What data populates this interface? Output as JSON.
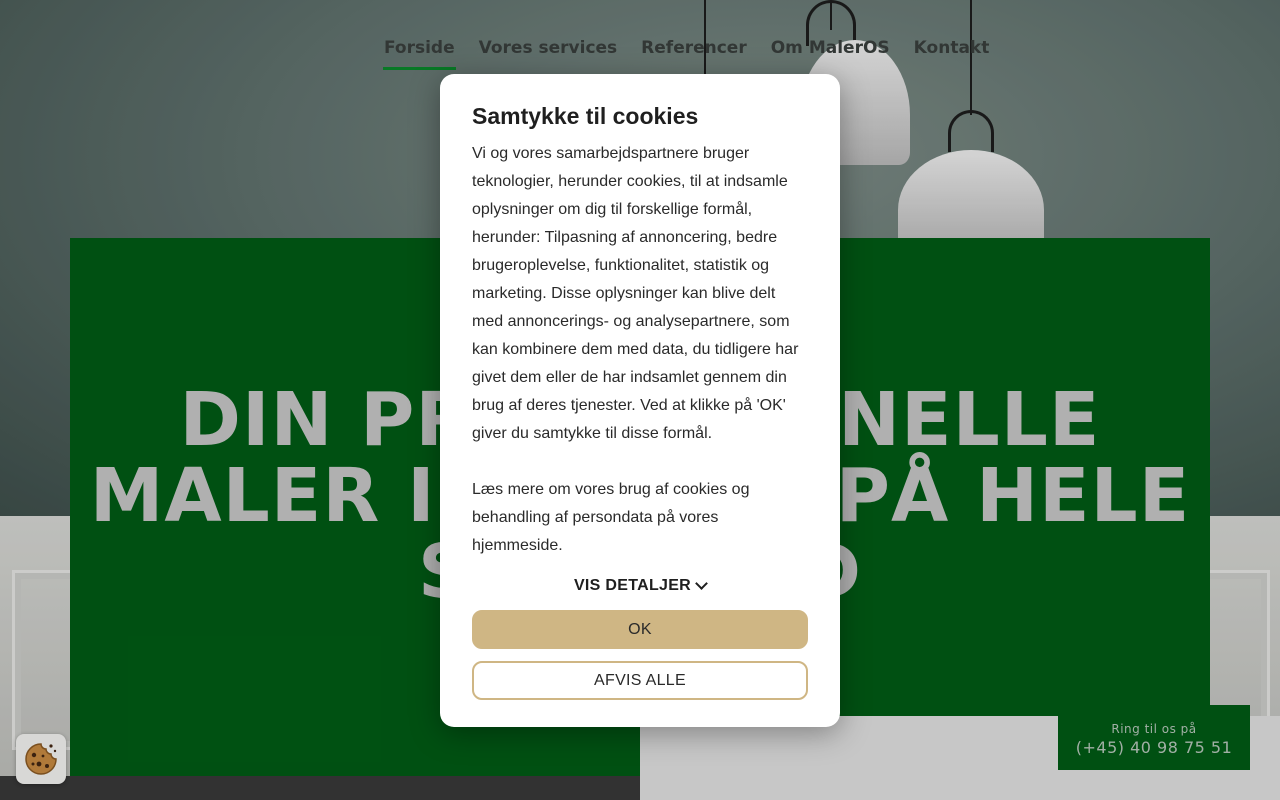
{
  "nav": {
    "items": [
      {
        "label": "Forside",
        "active": true
      },
      {
        "label": "Vores services",
        "active": false
      },
      {
        "label": "Referencer",
        "active": false
      },
      {
        "label": "Om MalerOS",
        "active": false
      },
      {
        "label": "Kontakt",
        "active": false
      }
    ]
  },
  "hero": {
    "line1": "DIN PROFESSIONELLE",
    "line2": "MALER I ODENSE PÅ HELE",
    "line3": "SJÆLLAND"
  },
  "call": {
    "label": "Ring til os på",
    "number": "(+45) 40 98 75 51"
  },
  "cookie_dialog": {
    "title": "Samtykke til cookies",
    "paragraph1": "Vi og vores samarbejdspartnere bruger teknologier, herunder cookies, til at indsamle oplysninger om dig til forskellige formål, herunder: Tilpasning af annoncering, bedre brugeroplevelse, funktionalitet, statistik og marketing. Disse oplysninger kan blive delt med annoncerings- og analysepartnere, som kan kombinere dem med data, du tidligere har givet dem eller de har indsamlet gennem din brug af deres tjenester. Ved at klikke på 'OK' giver du samtykke til disse formål.",
    "paragraph2": "Læs mere om vores brug af cookies og behandling af persondata på vores hjemmeside.",
    "details_label": "VIS DETALJER",
    "ok_label": "OK",
    "reject_label": "AFVIS ALLE"
  },
  "colors": {
    "hero_green": "#005c15",
    "nav_active": "#0a8a2c",
    "button_gold": "#cfb684"
  }
}
